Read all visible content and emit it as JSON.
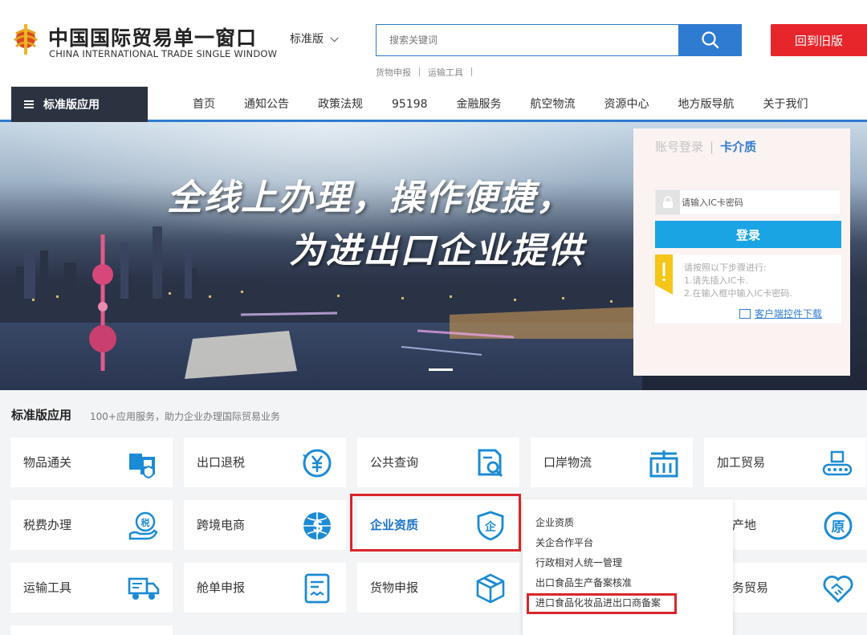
{
  "header": {
    "brand_cn": "中国国际贸易单一窗口",
    "brand_en": "CHINA INTERNATIONAL TRADE SINGLE WINDOW",
    "edition_label": "标准版",
    "search_placeholder": "搜索关键词",
    "quick_links": [
      "货物申报",
      "运输工具"
    ],
    "old_version_button": "回到旧版"
  },
  "nav": {
    "menu_button": "标准版应用",
    "items": [
      "首页",
      "通知公告",
      "政策法规",
      "95198",
      "金融服务",
      "航空物流",
      "资源中心",
      "地方版导航",
      "关于我们"
    ]
  },
  "banner": {
    "slogan_line1": "全线上办理，操作便捷，",
    "slogan_line2": "为进出口企业提供"
  },
  "login": {
    "tab_account": "账号登录",
    "tab_card": "卡介质",
    "pin_placeholder": "请输入IC卡密码",
    "login_button": "登录",
    "notice_lines": [
      "请按照以下步骤进行:",
      "1.请先插入IC卡.",
      "2.在输入框中输入IC卡密码."
    ],
    "download_link": "客户端控件下载"
  },
  "apps": {
    "title": "标准版应用",
    "subtitle": "100+应用服务，助力企业办理国际贸易业务",
    "tiles": [
      {
        "label": "物品通关",
        "icon": "goods-clearance-icon"
      },
      {
        "label": "出口退税",
        "icon": "yuan-refund-icon"
      },
      {
        "label": "公共查询",
        "icon": "document-search-icon"
      },
      {
        "label": "口岸物流",
        "icon": "port-crane-icon"
      },
      {
        "label": "加工贸易",
        "icon": "conveyor-icon"
      },
      {
        "label": "税费办理",
        "icon": "tax-hand-icon"
      },
      {
        "label": "跨境电商",
        "icon": "globe-dollar-icon"
      },
      {
        "label": "企业资质",
        "icon": "shield-enterprise-icon"
      },
      {
        "label": "运输工具",
        "icon": "truck-icon"
      },
      {
        "label": "舱单申报",
        "icon": "manifest-icon"
      },
      {
        "label": "货物申报",
        "icon": "box-icon"
      }
    ],
    "partial_tiles": [
      {
        "label": "产地",
        "icon": "origin-circle-icon"
      },
      {
        "label": "务贸易",
        "icon": "handshake-icon"
      }
    ],
    "dropdown_items": [
      "企业资质",
      "关企合作平台",
      "行政相对人统一管理",
      "出口食品生产备案核准",
      "进口食品化妆品进出口商备案"
    ]
  },
  "colors": {
    "primary_blue": "#2f7bd1",
    "red": "#e7262c",
    "icon_blue": "#1a8bd4",
    "highlight_red": "#d8262a"
  }
}
